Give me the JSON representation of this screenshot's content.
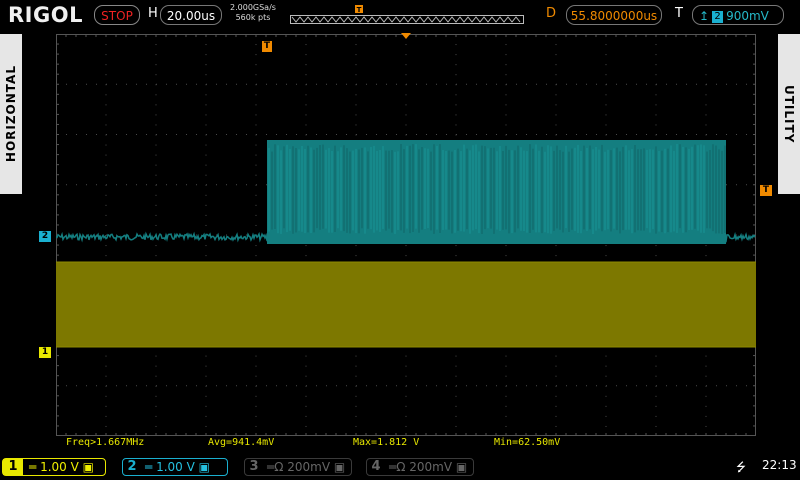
{
  "brand": "RIGOL",
  "run_state": "STOP",
  "horizontal": {
    "label": "H",
    "scale": "20.00us",
    "sample_rate": "2.000GSa/s",
    "memory_depth": "560k pts"
  },
  "delay": {
    "label": "D",
    "value": "55.8000000us"
  },
  "trigger": {
    "label": "T",
    "source": "2",
    "level": "900mV",
    "slope": "rising"
  },
  "side_tabs": {
    "left": "HORIZONTAL",
    "right": "UTILITY"
  },
  "measurements": {
    "freq": "Freq>1.667MHz",
    "avg": "Avg=941.4mV",
    "max": "Max=1.812 V",
    "min": "Min=62.50mV"
  },
  "channels": [
    {
      "num": "1",
      "scale": "1.00 V",
      "coupling": "DC",
      "color": "#f0f000",
      "active": true
    },
    {
      "num": "2",
      "scale": "1.00 V",
      "coupling": "DC",
      "color": "#1ab0d0",
      "active": true
    },
    {
      "num": "3",
      "scale": "200mV",
      "coupling": "DC",
      "color": "#5a5a5a",
      "active": false
    },
    {
      "num": "4",
      "scale": "200mV",
      "coupling": "DC",
      "color": "#5a5a5a",
      "active": false
    }
  ],
  "channel_markers": {
    "ch1": "1",
    "ch2": "2",
    "trigger": "T"
  },
  "clock": "22:13",
  "colors": {
    "ch1_trace": "#7d7800",
    "ch2_trace": "#147e80",
    "delay": "#f08a00",
    "grid": "#3c3c3c"
  }
}
